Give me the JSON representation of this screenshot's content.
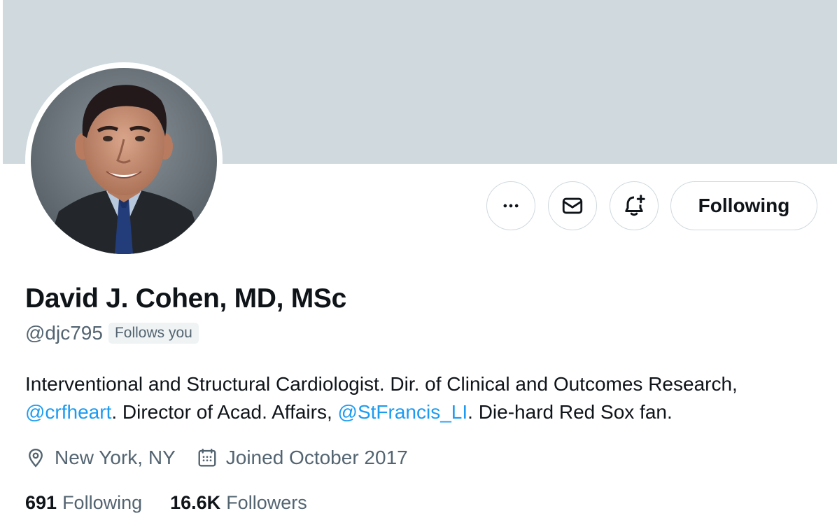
{
  "profile": {
    "name": "David J. Cohen, MD, MSc",
    "handle": "@djc795",
    "follows_you_label": "Follows you",
    "bio": {
      "line1": "Interventional and Structural Cardiologist.  Dir. of Clinical and Outcomes Research,",
      "mention1": "@crfheart",
      "text2": ".  Director of Acad. Affairs, ",
      "mention2": "@StFrancis_LI",
      "text3": ". Die-hard Red Sox fan."
    },
    "location": "New York, NY",
    "joined": "Joined October 2017",
    "stats": {
      "following_count": "691",
      "following_label": "Following",
      "followers_count": "16.6K",
      "followers_label": "Followers"
    }
  },
  "actions": {
    "more_icon": "more-horizontal-icon",
    "message_icon": "envelope-icon",
    "notify_icon": "bell-plus-icon",
    "following_button_label": "Following"
  },
  "icons": {
    "location": "map-pin-icon",
    "joined": "calendar-icon"
  },
  "colors": {
    "banner": "#cfd9de",
    "accent": "#1d9bf0",
    "secondary_text": "#536471",
    "primary_text": "#0f1419",
    "border": "#cfd9de"
  }
}
